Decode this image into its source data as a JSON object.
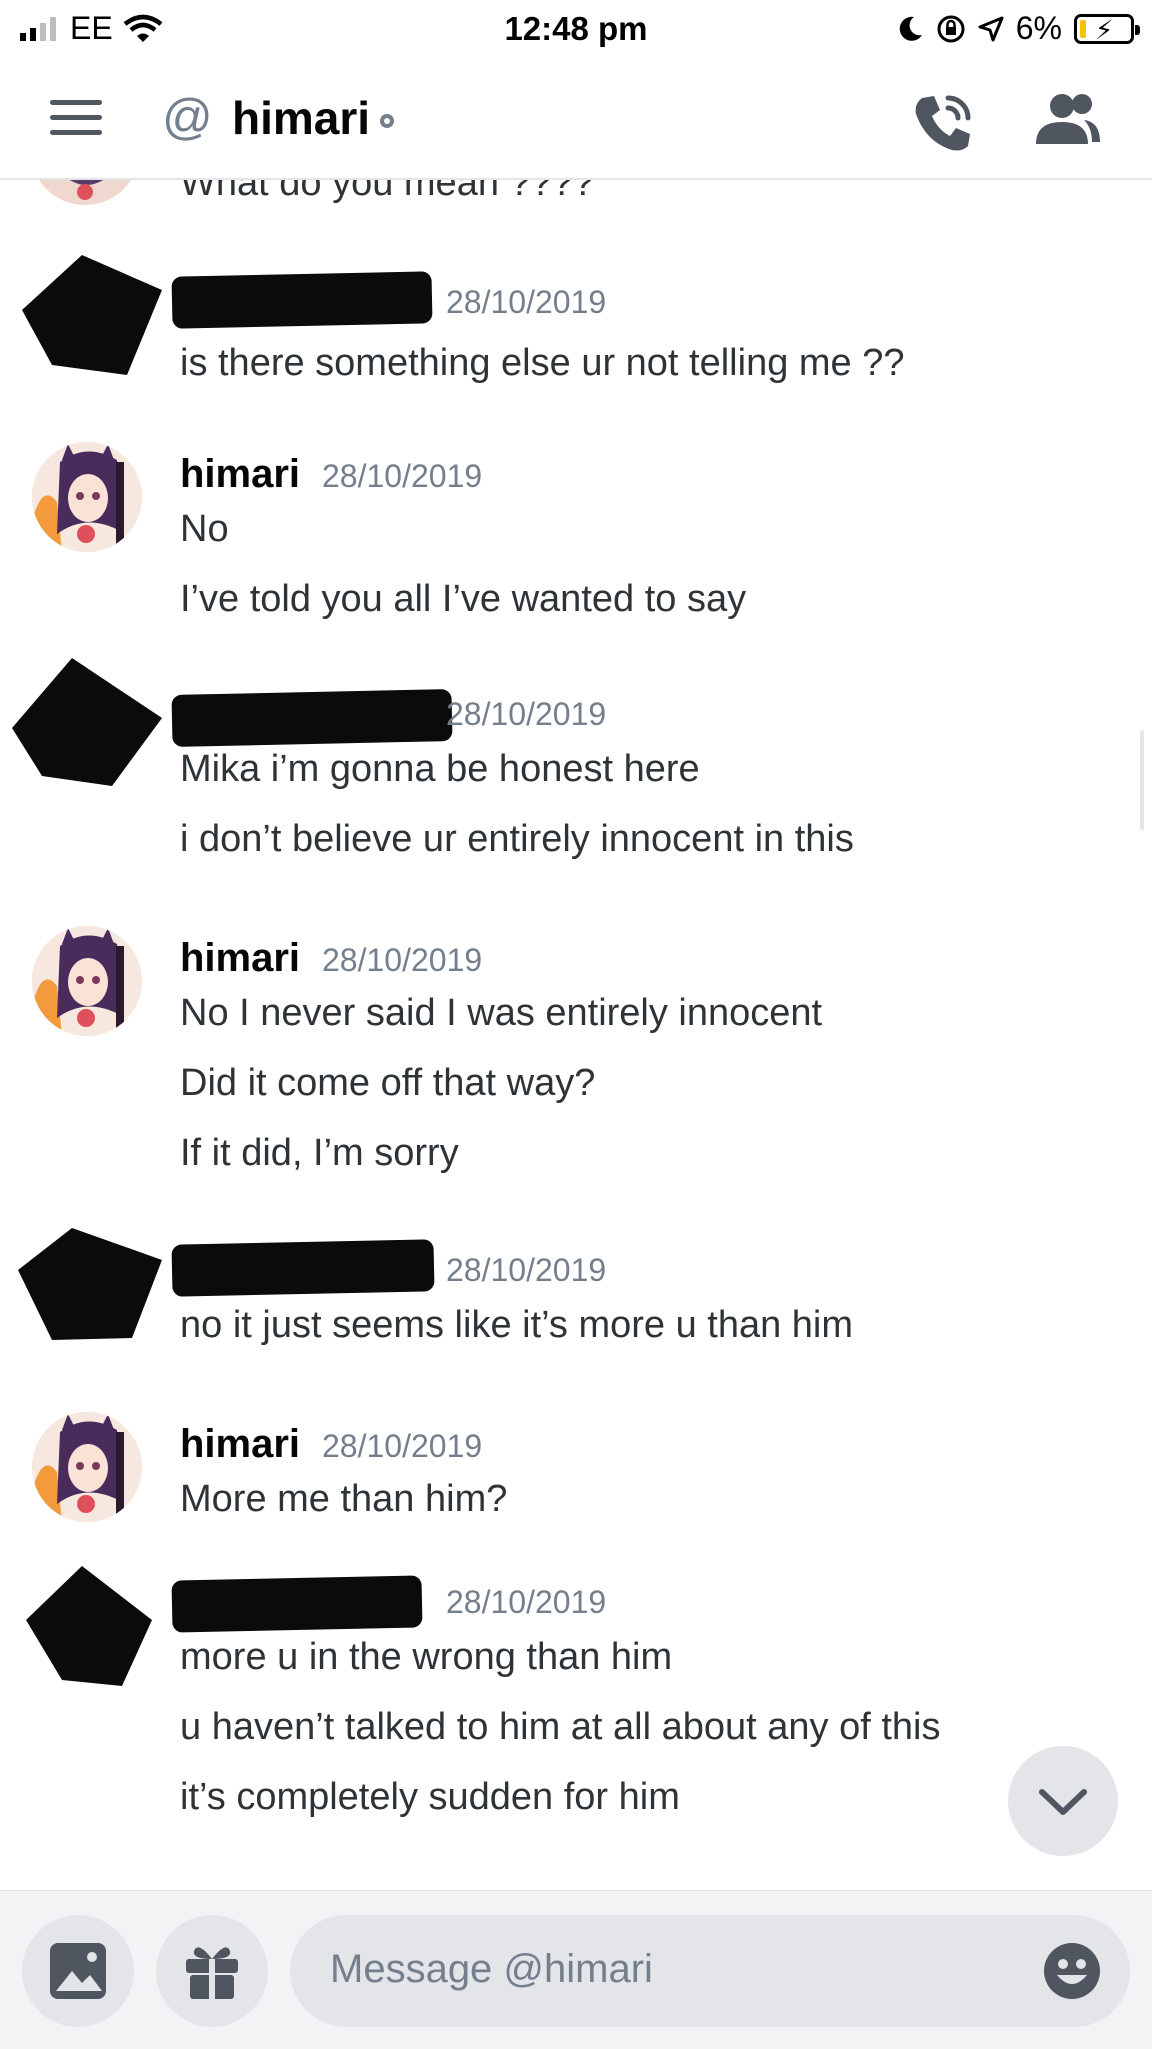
{
  "status_bar": {
    "carrier": "EE",
    "time": "12:48 pm",
    "battery": "6%",
    "battery_level": 0.06
  },
  "header": {
    "channel_name": "himari"
  },
  "messages": {
    "cut_off_line": "What do you mean ????",
    "groups": [
      {
        "author": "",
        "timestamp": "28/10/2019",
        "lines": [
          "is there something else ur not telling me ??"
        ]
      },
      {
        "author": "himari",
        "timestamp": "28/10/2019",
        "lines": [
          "No",
          "I’ve told you all I’ve wanted to say"
        ]
      },
      {
        "author": "",
        "timestamp": "28/10/2019",
        "lines": [
          "Mika i’m gonna be honest here",
          "i don’t believe ur entirely innocent in this"
        ]
      },
      {
        "author": "himari",
        "timestamp": "28/10/2019",
        "lines": [
          "No I never said I was entirely innocent",
          "Did it come off that way?",
          "If it did, I’m sorry"
        ]
      },
      {
        "author": "",
        "timestamp": "28/10/2019",
        "lines": [
          "no it just seems like it’s more u than him"
        ]
      },
      {
        "author": "himari",
        "timestamp": "28/10/2019",
        "lines": [
          "More me than him?"
        ]
      },
      {
        "author": "",
        "timestamp": "28/10/2019",
        "lines": [
          "more u in the wrong than him",
          "u haven’t talked to him at all about any of this",
          "it’s completely sudden for him"
        ]
      }
    ]
  },
  "composer": {
    "placeholder": "Message @himari"
  },
  "icons": {
    "menu": "hamburger-menu-icon",
    "mention": "at-icon",
    "call": "phone-call-icon",
    "members": "members-icon",
    "scroll": "chevron-down-icon",
    "image": "image-icon",
    "gift": "gift-icon",
    "emoji": "emoji-icon"
  },
  "colors": {
    "text": "#2e3338",
    "muted": "#747f8d",
    "surface": "#f2f3f5",
    "control": "#e3e5e8"
  }
}
